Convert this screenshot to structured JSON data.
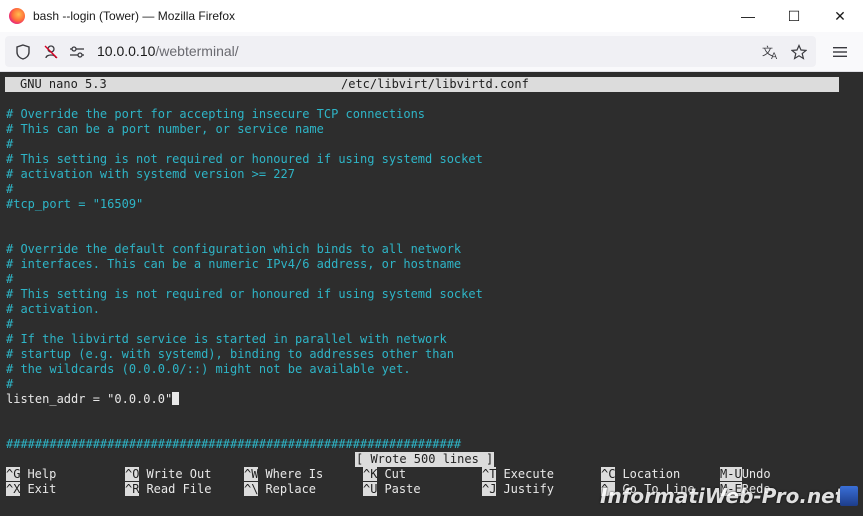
{
  "window": {
    "title": "bash --login (Tower) — Mozilla Firefox",
    "minimize_glyph": "—",
    "maximize_glyph": "☐",
    "close_glyph": "✕"
  },
  "navbar": {
    "url_host": "10.0.0.10",
    "url_path": "/webterminal/",
    "icons": [
      "shield-icon",
      "permissions-icon",
      "connection-icon",
      "translate-icon",
      "bookmark-star-icon",
      "hamburger-menu-icon"
    ]
  },
  "nano": {
    "version_label": "GNU nano 5.3",
    "filename": "/etc/libvirt/libvirtd.conf",
    "lines": [
      {
        "type": "comment",
        "text": "# Override the port for accepting insecure TCP connections"
      },
      {
        "type": "comment",
        "text": "# This can be a port number, or service name"
      },
      {
        "type": "comment",
        "text": "#"
      },
      {
        "type": "comment",
        "text": "# This setting is not required or honoured if using systemd socket"
      },
      {
        "type": "comment",
        "text": "# activation with systemd version >= 227"
      },
      {
        "type": "comment",
        "text": "#"
      },
      {
        "type": "comment",
        "text": "#tcp_port = \"16509\""
      },
      {
        "type": "plain",
        "text": ""
      },
      {
        "type": "plain",
        "text": ""
      },
      {
        "type": "comment",
        "text": "# Override the default configuration which binds to all network"
      },
      {
        "type": "comment",
        "text": "# interfaces. This can be a numeric IPv4/6 address, or hostname"
      },
      {
        "type": "comment",
        "text": "#"
      },
      {
        "type": "comment",
        "text": "# This setting is not required or honoured if using systemd socket"
      },
      {
        "type": "comment",
        "text": "# activation."
      },
      {
        "type": "comment",
        "text": "#"
      },
      {
        "type": "comment",
        "text": "# If the libvirtd service is started in parallel with network"
      },
      {
        "type": "comment",
        "text": "# startup (e.g. with systemd), binding to addresses other than"
      },
      {
        "type": "comment",
        "text": "# the wildcards (0.0.0.0/::) might not be available yet."
      },
      {
        "type": "comment",
        "text": "#"
      },
      {
        "type": "plain",
        "text": "listen_addr = \"0.0.0.0\""
      },
      {
        "type": "plain",
        "text": ""
      },
      {
        "type": "plain",
        "text": ""
      },
      {
        "type": "hashbar",
        "text": "###############################################################"
      }
    ],
    "status_message": "[ Wrote 500 lines ]",
    "shortcuts_row1": [
      {
        "key": "^G",
        "label": "Help"
      },
      {
        "key": "^O",
        "label": "Write Out"
      },
      {
        "key": "^W",
        "label": "Where Is"
      },
      {
        "key": "^K",
        "label": "Cut"
      },
      {
        "key": "^T",
        "label": "Execute"
      },
      {
        "key": "^C",
        "label": "Location"
      },
      {
        "key": "M-U",
        "label": "Undo"
      }
    ],
    "shortcuts_row2": [
      {
        "key": "^X",
        "label": "Exit"
      },
      {
        "key": "^R",
        "label": "Read File"
      },
      {
        "key": "^\\",
        "label": "Replace"
      },
      {
        "key": "^U",
        "label": "Paste"
      },
      {
        "key": "^J",
        "label": "Justify"
      },
      {
        "key": "^_",
        "label": "Go To Line"
      },
      {
        "key": "M-E",
        "label": "Redo"
      }
    ]
  },
  "watermark": "InformatiWeb-Pro.net",
  "colors": {
    "terminal_bg": "#2d2d2d",
    "comment": "#2eb5c7",
    "text": "#e8e8e8",
    "inverse_bg": "#dcdcdc"
  }
}
